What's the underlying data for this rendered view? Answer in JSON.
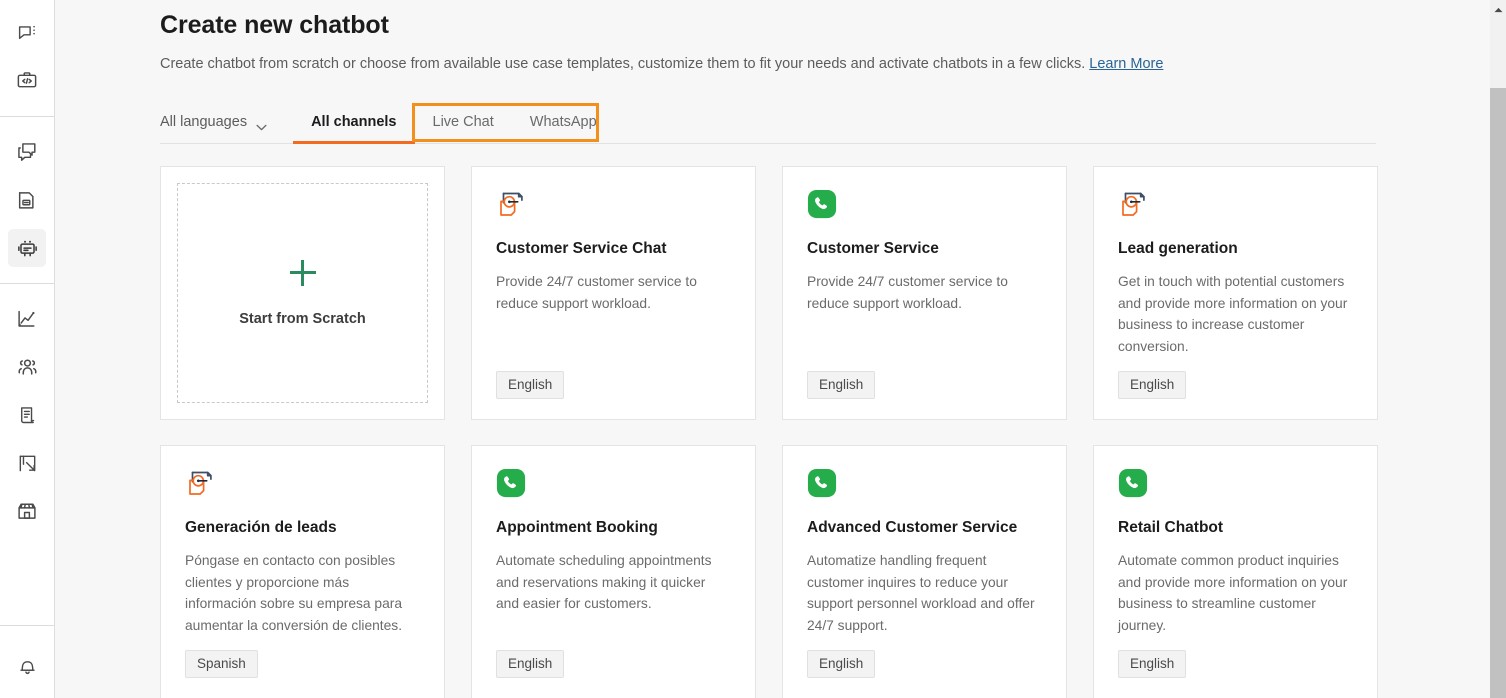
{
  "sidebar": {
    "groups": [
      {
        "items": [
          {
            "name": "conversations-icon",
            "label": "Conversations",
            "active": false
          },
          {
            "name": "developer-toolkit-icon",
            "label": "Developer Toolkit",
            "active": false
          }
        ]
      },
      {
        "items": [
          {
            "name": "chat-widget-icon",
            "label": "Chat Widget",
            "active": false
          },
          {
            "name": "inbox-icon",
            "label": "Inbox",
            "active": false
          },
          {
            "name": "chatbot-icon",
            "label": "Chatbots",
            "active": true
          }
        ]
      },
      {
        "items": [
          {
            "name": "analytics-icon",
            "label": "Analytics",
            "active": false
          },
          {
            "name": "contacts-icon",
            "label": "Contacts",
            "active": false
          },
          {
            "name": "knowledge-base-icon",
            "label": "Knowledge Base",
            "active": false
          },
          {
            "name": "campaigns-icon",
            "label": "Campaigns",
            "active": false
          },
          {
            "name": "storefront-icon",
            "label": "Storefront",
            "active": false
          }
        ]
      }
    ],
    "bottom": [
      {
        "name": "notifications-bell-icon",
        "label": "Notifications",
        "active": false
      }
    ],
    "active_indicator_color": "#f26b21"
  },
  "header": {
    "title": "Create new chatbot",
    "description_before": "Create chatbot from scratch or choose from available use case templates, customize them to fit your needs and activate chatbots in a few clicks. ",
    "learn_more_label": "Learn More",
    "learn_more_color": "#2a6496"
  },
  "toolbar": {
    "language_filter": {
      "label": "All languages",
      "icon": "chevron-down-icon"
    },
    "tabs": [
      {
        "label": "All channels",
        "active": true
      },
      {
        "label": "Live Chat",
        "active": false
      },
      {
        "label": "WhatsApp",
        "active": false
      }
    ],
    "active_tab_underline_color": "#f26b21",
    "highlight_box_color": "#f3901d",
    "highlight_covers": [
      "Live Chat",
      "WhatsApp"
    ]
  },
  "cards": [
    {
      "type": "scratch",
      "icon": "plus-icon",
      "title": "Start from Scratch",
      "description": "",
      "language": "",
      "plus_color": "#2c8a5f"
    },
    {
      "type": "template",
      "icon": "live-chat-icon",
      "title": "Customer Service Chat",
      "description": "Provide 24/7 customer service to reduce support workload.",
      "language": "English"
    },
    {
      "type": "template",
      "icon": "whatsapp-icon",
      "title": "Customer Service",
      "description": "Provide 24/7 customer service to reduce support workload.",
      "language": "English"
    },
    {
      "type": "template",
      "icon": "live-chat-icon",
      "title": "Lead generation",
      "description": "Get in touch with potential customers and provide more information on your business to increase customer conversion.",
      "language": "English"
    },
    {
      "type": "template",
      "icon": "live-chat-icon",
      "title": "Generación de leads",
      "description": "Póngase en contacto con posibles clientes y proporcione más información sobre su empresa para aumentar la conversión de clientes.",
      "language": "Spanish"
    },
    {
      "type": "template",
      "icon": "whatsapp-icon",
      "title": "Appointment Booking",
      "description": "Automate scheduling appointments and reservations making it quicker and easier for customers.",
      "language": "English"
    },
    {
      "type": "template",
      "icon": "whatsapp-icon",
      "title": "Advanced Customer Service",
      "description": "Automatize handling frequent customer inquires to reduce your support personnel workload and offer 24/7 support.",
      "language": "English"
    },
    {
      "type": "template",
      "icon": "whatsapp-icon",
      "title": "Retail Chatbot",
      "description": "Automate common product inquiries and provide more information on your business to streamline customer journey.",
      "language": "English"
    }
  ],
  "scrollbar": {
    "up_arrow_icon": "triangle-up-icon",
    "thumb_color": "#c1c1c1",
    "track_color": "#f1f1f1"
  }
}
